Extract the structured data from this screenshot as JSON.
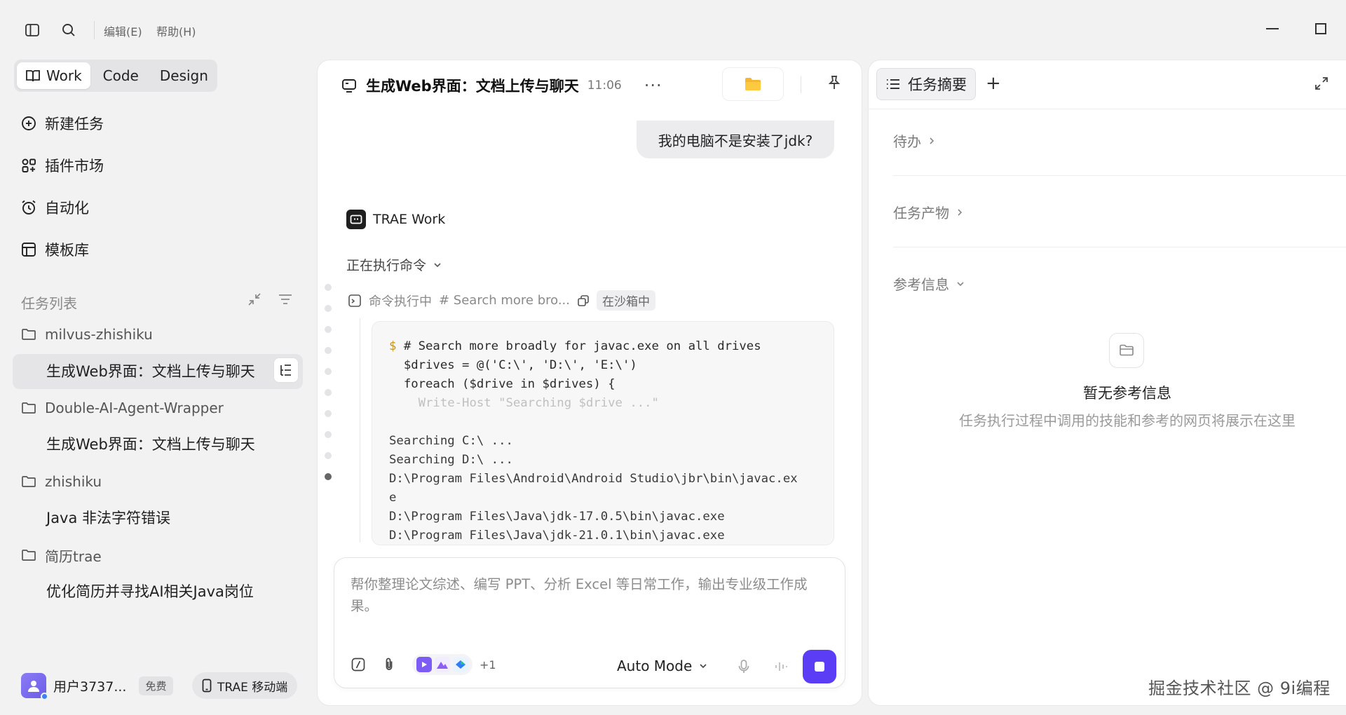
{
  "menu": {
    "edit": "编辑(E)",
    "help": "帮助(H)"
  },
  "modes": [
    {
      "label": "Work",
      "active": true
    },
    {
      "label": "Code",
      "active": false
    },
    {
      "label": "Design",
      "active": false
    }
  ],
  "nav": [
    {
      "label": "新建任务",
      "icon": "plus-circle-icon"
    },
    {
      "label": "插件市场",
      "icon": "plugins-icon"
    },
    {
      "label": "自动化",
      "icon": "alarm-clock-icon"
    },
    {
      "label": "模板库",
      "icon": "template-icon"
    }
  ],
  "tasklist": {
    "title": "任务列表",
    "groups": [
      {
        "folder": "milvus-zhishiku",
        "tasks": [
          "生成Web界面：文档上传与聊天"
        ]
      },
      {
        "folder": "Double-AI-Agent-Wrapper",
        "tasks": [
          "生成Web界面：文档上传与聊天"
        ]
      },
      {
        "folder": "zhishiku",
        "tasks": [
          "Java 非法字符错误"
        ]
      },
      {
        "folder": "简历trae",
        "tasks": [
          "优化简历并寻找AI相关Java岗位"
        ]
      }
    ]
  },
  "user": {
    "name": "用户3737...",
    "plan": "免费",
    "mobile": "TRAE 移动端"
  },
  "chat": {
    "title": "生成Web界面：文档上传与聊天",
    "time": "11:06",
    "more": "···",
    "user_message": "我的电脑不是安装了jdk?",
    "bot_name": "TRAE Work",
    "status": "正在执行命令",
    "command_label": "命令执行中",
    "command_preview": "# Search more bro...",
    "sandbox": "在沙箱中",
    "code": {
      "prompt": "$",
      "lines": [
        "# Search more broadly for javac.exe on all drives",
        "$drives = @('C:\\', 'D:\\', 'E:\\')",
        "foreach ($drive in $drives) {",
        "  Write-Host \"Searching $drive ...\""
      ],
      "output": [
        "Searching C:\\ ...",
        "Searching D:\\ ...",
        "D:\\Program Files\\Android\\Android Studio\\jbr\\bin\\javac.ex",
        "e",
        "D:\\Program Files\\Java\\jdk-17.0.5\\bin\\javac.exe",
        "D:\\Program Files\\Java\\jdk-21.0.1\\bin\\javac.exe"
      ]
    },
    "input_placeholder": "帮你整理论文综述、编写 PPT、分析 Excel 等日常工作，输出专业级工作成果。",
    "plus_more": "+1",
    "mode": "Auto Mode",
    "accent": "#5b3df5"
  },
  "right": {
    "tab": "任务摘要",
    "sections": [
      "待办",
      "任务产物",
      "参考信息"
    ],
    "empty_title": "暂无参考信息",
    "empty_desc": "任务执行过程中调用的技能和参考的网页将展示在这里"
  },
  "watermark": "掘金技术社区 @ 9i编程"
}
